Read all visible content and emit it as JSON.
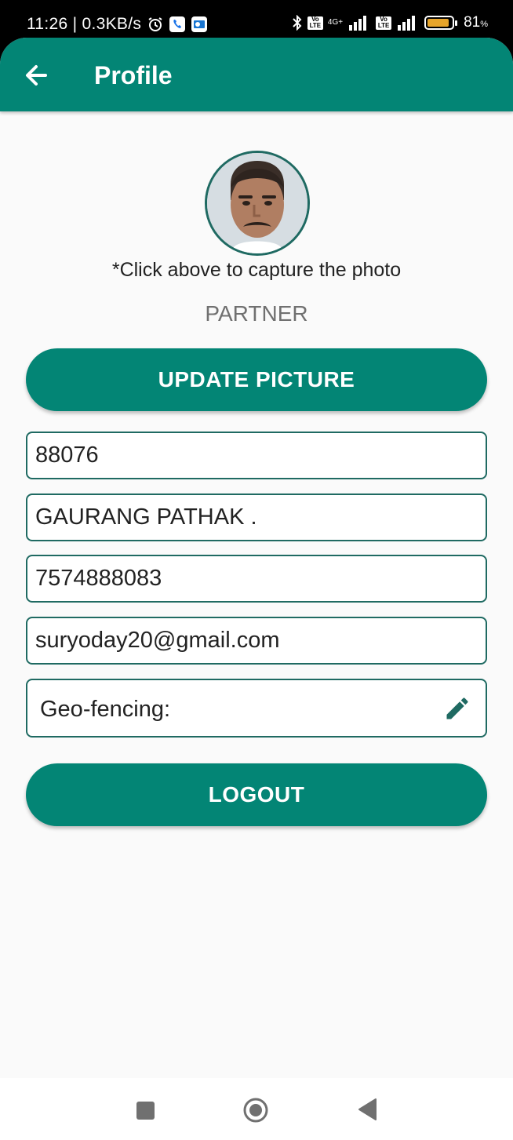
{
  "status_bar": {
    "time_speed": "11:26 | 0.3KB/s",
    "network_type": "4G+",
    "volte_label": "Vo LTE",
    "battery_percent": "81",
    "battery_unit": "%",
    "battery_color": "#e7a52b",
    "icons": [
      "alarm-icon",
      "phone-icon",
      "outlook-icon",
      "bluetooth-icon",
      "volte-icon",
      "signal-icon",
      "battery-icon"
    ]
  },
  "app_bar": {
    "title": "Profile",
    "back_icon": "arrow-left-icon",
    "color": "#038575"
  },
  "profile": {
    "photo_hint": "*Click above to capture the photo",
    "role": "PARTNER",
    "update_picture_label": "UPDATE PICTURE"
  },
  "fields": {
    "user_id": "88076",
    "name": "GAURANG PATHAK .",
    "phone": "7574888083",
    "email": "suryoday20@gmail.com",
    "geo_fencing_label": "Geo-fencing:",
    "geo_fencing_edit_icon": "pencil-icon"
  },
  "actions": {
    "logout_label": "LOGOUT"
  },
  "nav_bar": {
    "icons": [
      "recents-square-icon",
      "home-circle-icon",
      "back-triangle-icon"
    ]
  }
}
